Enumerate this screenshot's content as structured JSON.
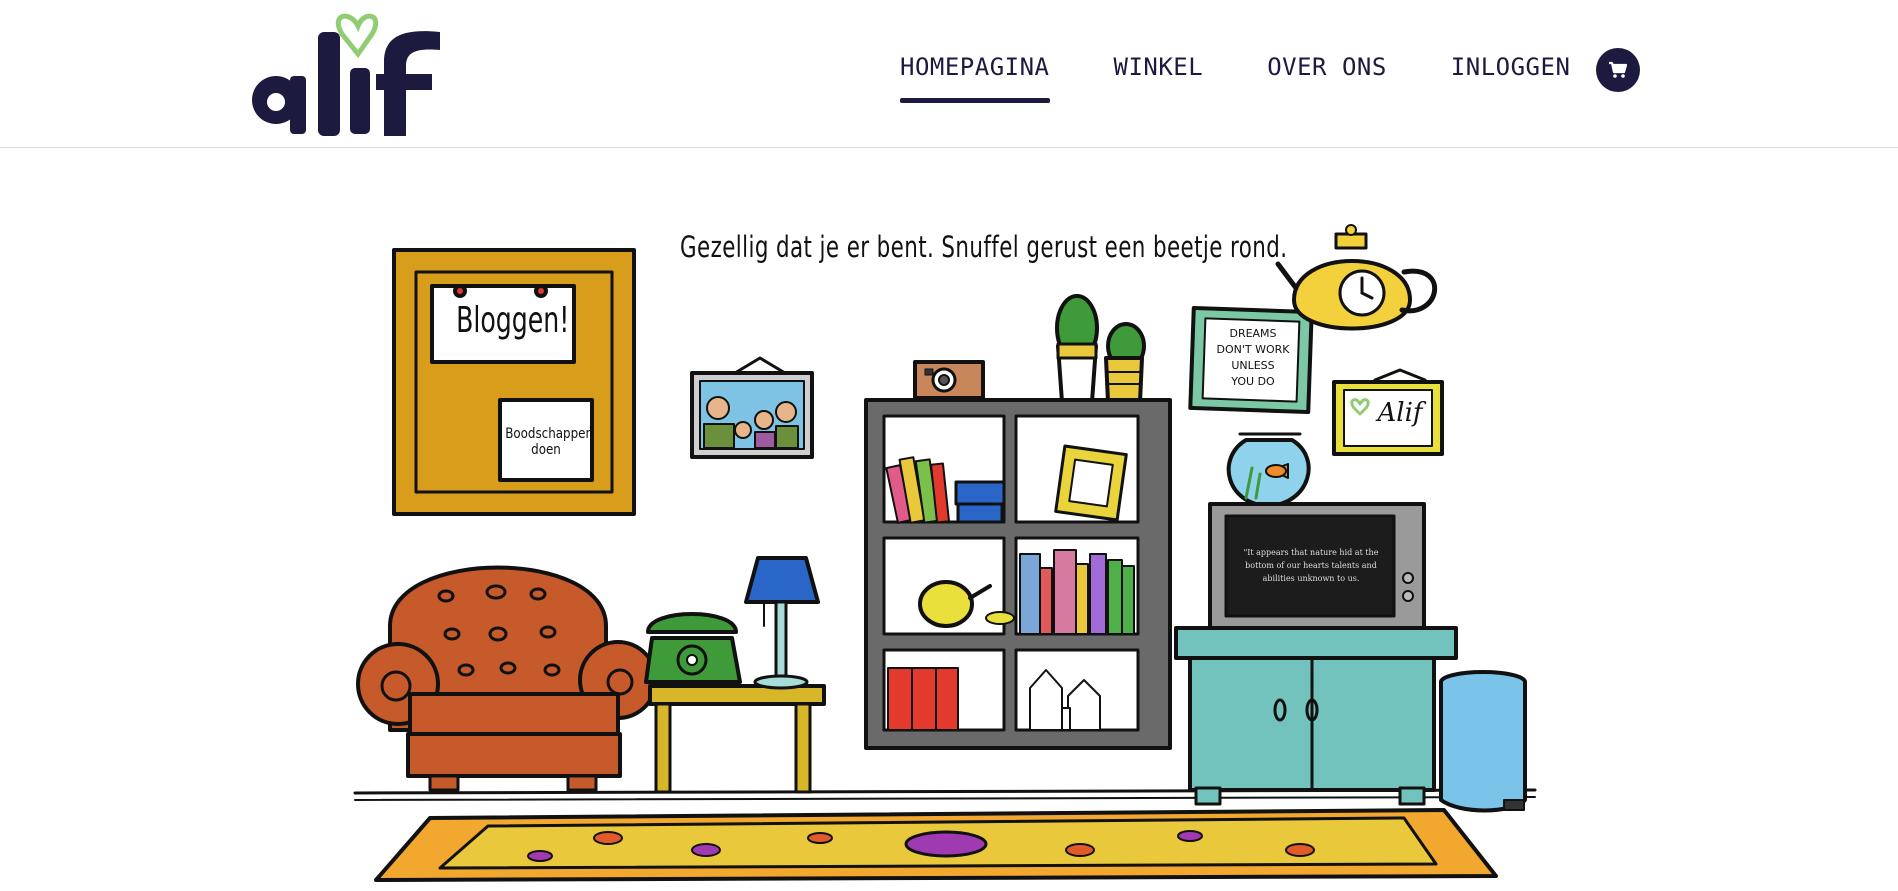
{
  "logo": {
    "text": "alif"
  },
  "nav": {
    "items": [
      {
        "label": "HOMEPAGINA",
        "active": true
      },
      {
        "label": "WINKEL",
        "active": false
      },
      {
        "label": "OVER ONS",
        "active": false
      },
      {
        "label": "INLOGGEN",
        "active": false
      }
    ],
    "cart_icon": "shopping-cart-icon"
  },
  "scene": {
    "welcome": "Gezellig dat je er bent. Snuffel gerust een beetje rond.",
    "board_note": "Bloggen!",
    "shopping_note_line1": "Boodschappen",
    "shopping_note_line2": "doen",
    "poster_line1": "DREAMS",
    "poster_line2": "DON'T WORK",
    "poster_line3": "UNLESS",
    "poster_line4": "YOU DO",
    "frame_logo": "Alif",
    "tv_quote_line1": "\"It appears that nature hid at the",
    "tv_quote_line2": "bottom of our hearts talents and",
    "tv_quote_line3": "abilities unknown to us."
  },
  "colors": {
    "brand_navy": "#1d1a40",
    "brand_green": "#8fcc72",
    "board_gold": "#d89d1a",
    "armchair": "#c65a2a",
    "cabinet": "#72c2bd",
    "bin": "#79c4e8"
  }
}
